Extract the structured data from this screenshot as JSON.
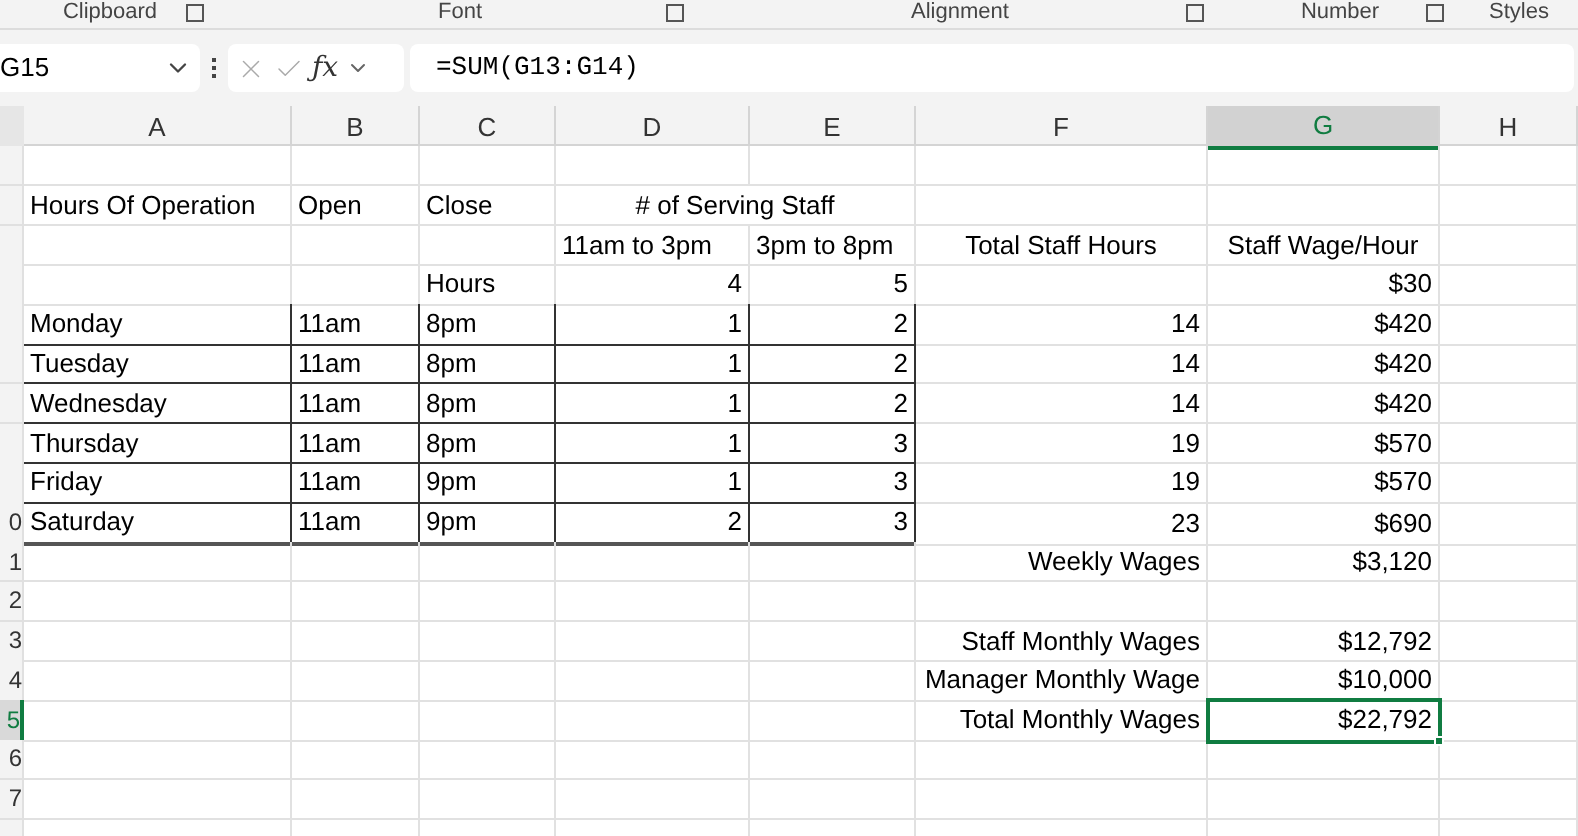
{
  "ribbon_groups": [
    {
      "label": "Clipboard",
      "launcher": true
    },
    {
      "label": "Font",
      "launcher": true
    },
    {
      "label": "Alignment",
      "launcher": true
    },
    {
      "label": "Number",
      "launcher": true
    },
    {
      "label": "Styles",
      "launcher": false
    }
  ],
  "name_box": "G15",
  "function_button": "ƒx",
  "formula": "=SUM(G13:G14)",
  "columns": [
    {
      "label": "A",
      "selected": false
    },
    {
      "label": "B",
      "selected": false
    },
    {
      "label": "C",
      "selected": false
    },
    {
      "label": "D",
      "selected": false
    },
    {
      "label": "E",
      "selected": false
    },
    {
      "label": "F",
      "selected": false
    },
    {
      "label": "G",
      "selected": true
    },
    {
      "label": "H",
      "selected": false
    }
  ],
  "rows": [
    {
      "selected": false,
      "bordered": false,
      "cells": [
        null,
        null,
        null,
        null,
        null,
        null,
        null,
        null
      ]
    },
    {
      "selected": false,
      "bordered": false,
      "cells": [
        {
          "text": "Hours Of Operation",
          "kind": "text"
        },
        {
          "text": "Open",
          "kind": "text"
        },
        {
          "text": "Close",
          "kind": "text"
        },
        {
          "text": "# of Serving Staff",
          "kind": "heading"
        },
        null,
        null,
        null,
        null
      ]
    },
    {
      "selected": false,
      "bordered": false,
      "cells": [
        null,
        null,
        null,
        {
          "text": "11am to 3pm",
          "kind": "text"
        },
        {
          "text": "3pm to 8pm",
          "kind": "text"
        },
        {
          "text": "Total Staff Hours",
          "kind": "heading"
        },
        {
          "text": "Staff Wage/Hour",
          "kind": "heading"
        },
        null
      ]
    },
    {
      "selected": false,
      "bordered": false,
      "cells": [
        null,
        null,
        {
          "text": "Hours",
          "kind": "text"
        },
        {
          "text": "4",
          "kind": "number"
        },
        {
          "text": "5",
          "kind": "number"
        },
        null,
        {
          "text": "$30",
          "kind": "number"
        },
        null
      ]
    },
    {
      "selected": false,
      "bordered": true,
      "cells": [
        {
          "text": "Monday",
          "kind": "text"
        },
        {
          "text": "11am",
          "kind": "text"
        },
        {
          "text": "8pm",
          "kind": "text"
        },
        {
          "text": "1",
          "kind": "number"
        },
        {
          "text": "2",
          "kind": "number"
        },
        {
          "text": "14",
          "kind": "number"
        },
        {
          "text": "$420",
          "kind": "number"
        },
        null
      ]
    },
    {
      "selected": false,
      "bordered": true,
      "cells": [
        {
          "text": "Tuesday",
          "kind": "text"
        },
        {
          "text": "11am",
          "kind": "text"
        },
        {
          "text": "8pm",
          "kind": "text"
        },
        {
          "text": "1",
          "kind": "number"
        },
        {
          "text": "2",
          "kind": "number"
        },
        {
          "text": "14",
          "kind": "number"
        },
        {
          "text": "$420",
          "kind": "number"
        },
        null
      ]
    },
    {
      "selected": false,
      "bordered": true,
      "cells": [
        {
          "text": "Wednesday",
          "kind": "text"
        },
        {
          "text": "11am",
          "kind": "text"
        },
        {
          "text": "8pm",
          "kind": "text"
        },
        {
          "text": "1",
          "kind": "number"
        },
        {
          "text": "2",
          "kind": "number"
        },
        {
          "text": "14",
          "kind": "number"
        },
        {
          "text": "$420",
          "kind": "number"
        },
        null
      ]
    },
    {
      "selected": false,
      "bordered": true,
      "cells": [
        {
          "text": "Thursday",
          "kind": "text"
        },
        {
          "text": "11am",
          "kind": "text"
        },
        {
          "text": "8pm",
          "kind": "text"
        },
        {
          "text": "1",
          "kind": "number"
        },
        {
          "text": "3",
          "kind": "number"
        },
        {
          "text": "19",
          "kind": "number"
        },
        {
          "text": "$570",
          "kind": "number"
        },
        null
      ]
    },
    {
      "selected": false,
      "bordered": true,
      "cells": [
        {
          "text": "Friday",
          "kind": "text"
        },
        {
          "text": "11am",
          "kind": "text"
        },
        {
          "text": "9pm",
          "kind": "text"
        },
        {
          "text": "1",
          "kind": "number"
        },
        {
          "text": "3",
          "kind": "number"
        },
        {
          "text": "19",
          "kind": "number"
        },
        {
          "text": "$570",
          "kind": "number"
        },
        null
      ]
    },
    {
      "header": "0",
      "selected": false,
      "bordered": true,
      "cells": [
        {
          "text": "Saturday",
          "kind": "text"
        },
        {
          "text": "11am",
          "kind": "text"
        },
        {
          "text": "9pm",
          "kind": "text"
        },
        {
          "text": "2",
          "kind": "number"
        },
        {
          "text": "3",
          "kind": "number"
        },
        {
          "text": "23",
          "kind": "number"
        },
        {
          "text": "$690",
          "kind": "number"
        },
        null
      ]
    },
    {
      "header": "1",
      "selected": false,
      "bordered": false,
      "cells": [
        null,
        null,
        null,
        null,
        null,
        {
          "text": "Weekly Wages",
          "kind": "number"
        },
        {
          "text": "$3,120",
          "kind": "number"
        },
        null
      ]
    },
    {
      "header": "2",
      "selected": false,
      "bordered": false,
      "cells": [
        null,
        null,
        null,
        null,
        null,
        null,
        null,
        null
      ]
    },
    {
      "header": "3",
      "selected": false,
      "bordered": false,
      "cells": [
        null,
        null,
        null,
        null,
        null,
        {
          "text": "Staff Monthly Wages",
          "kind": "number"
        },
        {
          "text": "$12,792",
          "kind": "number"
        },
        null
      ]
    },
    {
      "header": "4",
      "selected": false,
      "bordered": false,
      "cells": [
        null,
        null,
        null,
        null,
        null,
        {
          "text": "Manager Monthly Wage",
          "kind": "number"
        },
        {
          "text": "$10,000",
          "kind": "number"
        },
        null
      ]
    },
    {
      "header": "5",
      "selected": true,
      "bordered": false,
      "cells": [
        null,
        null,
        null,
        null,
        null,
        {
          "text": "Total Monthly Wages",
          "kind": "number"
        },
        {
          "text": "$22,792",
          "kind": "number",
          "selected": true
        },
        null
      ]
    },
    {
      "header": "6",
      "selected": false,
      "bordered": false,
      "cells": [
        null,
        null,
        null,
        null,
        null,
        null,
        null,
        null
      ]
    },
    {
      "header": "7",
      "selected": false,
      "bordered": false,
      "cells": [
        null,
        null,
        null,
        null,
        null,
        null,
        null,
        null
      ]
    },
    {
      "selected": false,
      "bordered": false,
      "cells": [
        null,
        null,
        null,
        null,
        null,
        null,
        null,
        null
      ]
    }
  ]
}
